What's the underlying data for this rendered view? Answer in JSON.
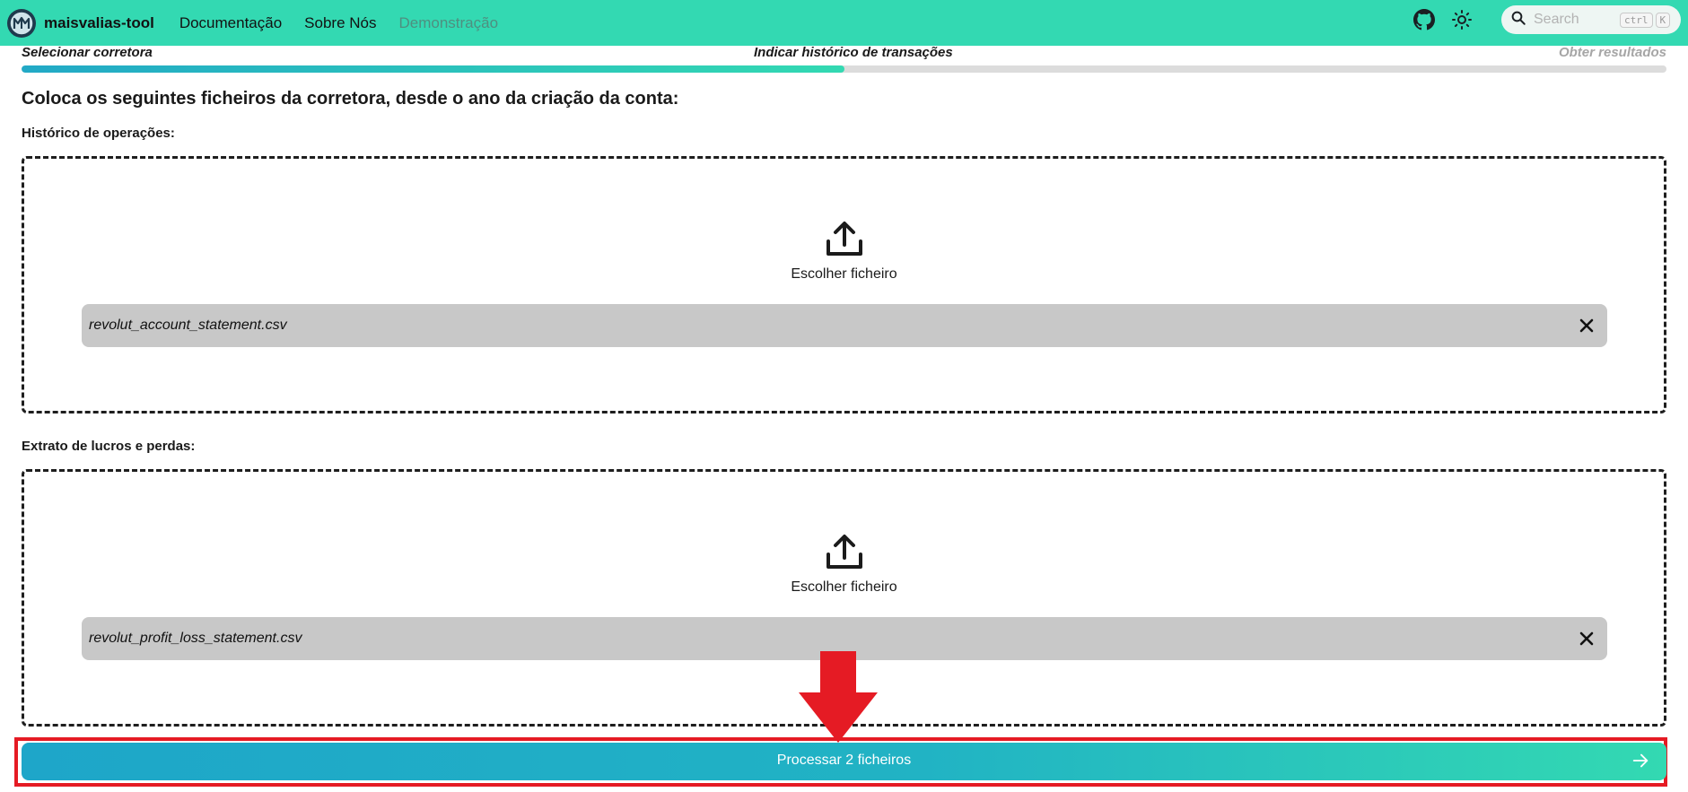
{
  "navbar": {
    "brand": "maisvalias-tool",
    "links": [
      {
        "label": "Documentação"
      },
      {
        "label": "Sobre Nós"
      },
      {
        "label": "Demonstração"
      }
    ],
    "search": {
      "placeholder": "Search",
      "shortcut": [
        "ctrl",
        "K"
      ]
    }
  },
  "stepper": {
    "steps": [
      {
        "label": "Selecionar corretora"
      },
      {
        "label": "Indicar histórico de transações"
      },
      {
        "label": "Obter resultados"
      }
    ],
    "progress_fraction": 0.5
  },
  "main": {
    "heading": "Coloca os seguintes ficheiros da corretora, desde o ano da criação da conta:",
    "sections": [
      {
        "label": "Histórico de operações:",
        "upload_text": "Escolher ficheiro",
        "file": "revolut_account_statement.csv"
      },
      {
        "label": "Extrato de lucros e perdas:",
        "upload_text": "Escolher ficheiro",
        "file": "revolut_profit_loss_statement.csv"
      }
    ],
    "submit_label": "Processar 2 ficheiros"
  },
  "colors": {
    "navbar": "#33d9b2",
    "button_start": "#1ea6c9",
    "button_end": "#33d9b2",
    "highlight": "#e51b24",
    "file_chip": "#c8c8c8"
  }
}
